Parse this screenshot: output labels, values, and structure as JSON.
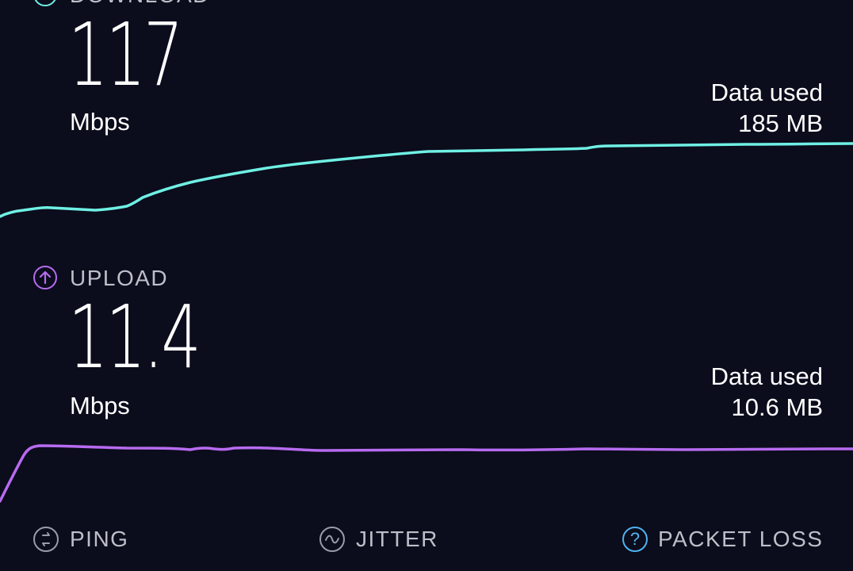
{
  "download": {
    "label": "DOWNLOAD",
    "value": "117",
    "unit": "Mbps",
    "data_used_label": "Data used",
    "data_used_value": "185 MB",
    "color": "#6ff0e4",
    "icon": "arrow-down-circle-icon"
  },
  "upload": {
    "label": "UPLOAD",
    "value": "11.4",
    "unit": "Mbps",
    "data_used_label": "Data used",
    "data_used_value": "10.6 MB",
    "color": "#b76bf0",
    "icon": "arrow-up-circle-icon"
  },
  "metrics": [
    {
      "label": "PING",
      "icon": "ping-icon"
    },
    {
      "label": "JITTER",
      "icon": "jitter-icon"
    },
    {
      "label": "PACKET LOSS",
      "icon": "help-icon",
      "icon_color": "#4fb3f0"
    }
  ],
  "colors": {
    "background": "#0b0c1c",
    "label_gray": "#bdbfc8"
  }
}
